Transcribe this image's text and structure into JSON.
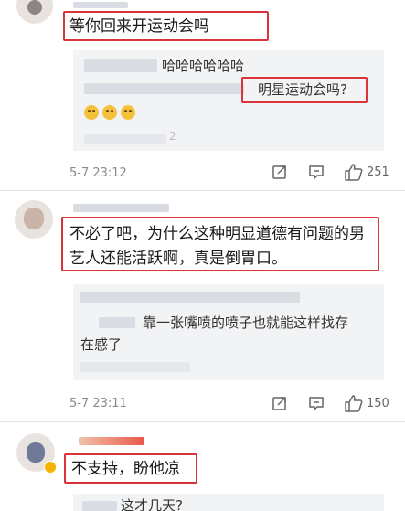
{
  "comments": [
    {
      "text": "等你回来开运动会吗",
      "replies": [
        {
          "text": "哈哈哈哈哈哈"
        },
        {
          "text": "明星运动会吗?"
        },
        {
          "text": "2"
        }
      ],
      "time": "5-7 23:12",
      "like_count": "251"
    },
    {
      "text_line1": "不必了吧，为什么这种明显道德有问题的男",
      "text_line2": "艺人还能活跃啊，真是倒胃口。",
      "replies": [
        {
          "text": "靠一张嘴喷的喷子也就能这样找存"
        },
        {
          "text": "在感了"
        }
      ],
      "time": "5-7 23:11",
      "like_count": "150"
    },
    {
      "text": "不支持，盼他凉",
      "replies": [
        {
          "text": "这才几天?"
        }
      ]
    }
  ],
  "icons": {
    "share": "share-icon",
    "comment": "comment-icon",
    "like": "thumbs-up-icon"
  },
  "colors": {
    "highlight_box": "#d9343a",
    "reply_bg": "#f2f3f5"
  }
}
